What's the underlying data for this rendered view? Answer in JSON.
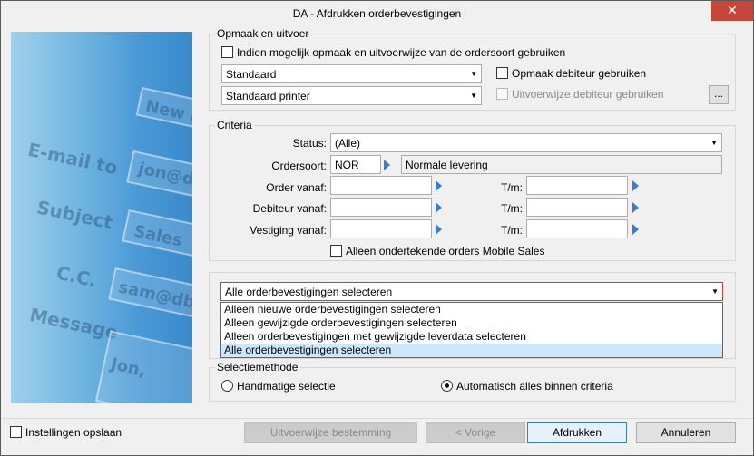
{
  "window": {
    "title": "DA - Afdrukken orderbevestigingen",
    "close_glyph": "✕"
  },
  "opmaak": {
    "group_title": "Opmaak en uitvoer",
    "use_ordersoort_label": "Indien mogelijk opmaak en uitvoerwijze van de ordersoort gebruiken",
    "layout_value": "Standaard",
    "printer_value": "Standaard printer",
    "debiteur_opmaak_label": "Opmaak debiteur gebruiken",
    "debiteur_uitvoer_label": "Uitvoerwijze debiteur gebruiken",
    "browse_label": "..."
  },
  "criteria": {
    "group_title": "Criteria",
    "status_label": "Status:",
    "status_value": "(Alle)",
    "ordersoort_label": "Ordersoort:",
    "ordersoort_code": "NOR",
    "ordersoort_desc": "Normale levering",
    "order_label": "Order vanaf:",
    "debiteur_label": "Debiteur vanaf:",
    "vestiging_label": "Vestiging vanaf:",
    "tm_label": "T/m:",
    "mobile_sales_label": "Alleen ondertekende orders Mobile Sales"
  },
  "selectie": {
    "current_value": "Alle orderbevestigingen selecteren",
    "options": [
      "Alleen nieuwe orderbevestigingen selecteren",
      "Alleen gewijzigde orderbevestigingen selecteren",
      "Alleen orderbevestigingen met gewijzigde leverdata selecteren",
      "Alle orderbevestigingen selecteren"
    ],
    "selected_index": 3
  },
  "methode": {
    "group_title": "Selectiemethode",
    "manual_label": "Handmatige selectie",
    "auto_label": "Automatisch alles binnen criteria",
    "selected": "auto"
  },
  "footer": {
    "save_settings_label": "Instellingen opslaan",
    "destination_button": "Uitvoerwijze bestemming",
    "prev_button": "< Vorige",
    "print_button": "Afdrukken",
    "cancel_button": "Annuleren"
  },
  "side_image_text": [
    "New a",
    "E-mail to",
    "Subject",
    "C.C.",
    "Message",
    "jon@db",
    "Sales",
    "sam@db",
    "Jon,"
  ]
}
